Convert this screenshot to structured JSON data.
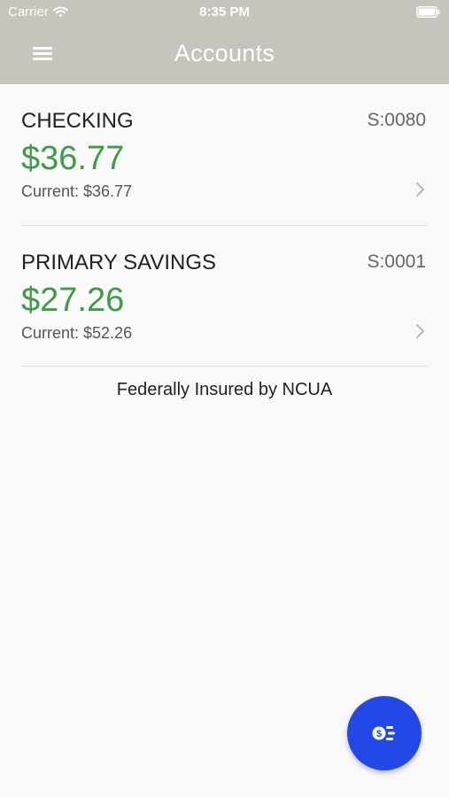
{
  "status_bar": {
    "carrier": "Carrier",
    "time": "8:35 PM"
  },
  "nav": {
    "title": "Accounts",
    "menu_icon": "hamburger-menu-icon"
  },
  "accounts": [
    {
      "name": "CHECKING",
      "suffix": "S:0080",
      "balance": "$36.77",
      "current": "Current: $36.77"
    },
    {
      "name": "PRIMARY SAVINGS",
      "suffix": "S:0001",
      "balance": "$27.26",
      "current": "Current: $52.26"
    }
  ],
  "footer": {
    "insured_text": "Federally Insured by NCUA"
  },
  "fab": {
    "icon": "money-transfer-icon"
  },
  "colors": {
    "header": "#c8c3bc",
    "balance": "#3e9b48",
    "fab": "#2249e8",
    "background": "#f9f9f9"
  }
}
